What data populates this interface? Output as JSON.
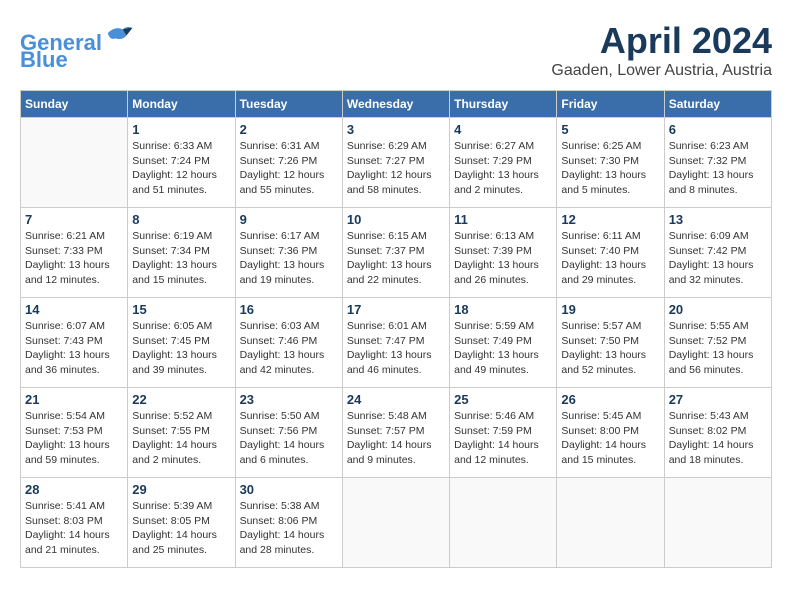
{
  "header": {
    "logo_line1": "General",
    "logo_line2": "Blue",
    "month": "April 2024",
    "location": "Gaaden, Lower Austria, Austria"
  },
  "weekdays": [
    "Sunday",
    "Monday",
    "Tuesday",
    "Wednesday",
    "Thursday",
    "Friday",
    "Saturday"
  ],
  "weeks": [
    [
      {
        "day": "",
        "info": ""
      },
      {
        "day": "1",
        "info": "Sunrise: 6:33 AM\nSunset: 7:24 PM\nDaylight: 12 hours\nand 51 minutes."
      },
      {
        "day": "2",
        "info": "Sunrise: 6:31 AM\nSunset: 7:26 PM\nDaylight: 12 hours\nand 55 minutes."
      },
      {
        "day": "3",
        "info": "Sunrise: 6:29 AM\nSunset: 7:27 PM\nDaylight: 12 hours\nand 58 minutes."
      },
      {
        "day": "4",
        "info": "Sunrise: 6:27 AM\nSunset: 7:29 PM\nDaylight: 13 hours\nand 2 minutes."
      },
      {
        "day": "5",
        "info": "Sunrise: 6:25 AM\nSunset: 7:30 PM\nDaylight: 13 hours\nand 5 minutes."
      },
      {
        "day": "6",
        "info": "Sunrise: 6:23 AM\nSunset: 7:32 PM\nDaylight: 13 hours\nand 8 minutes."
      }
    ],
    [
      {
        "day": "7",
        "info": "Sunrise: 6:21 AM\nSunset: 7:33 PM\nDaylight: 13 hours\nand 12 minutes."
      },
      {
        "day": "8",
        "info": "Sunrise: 6:19 AM\nSunset: 7:34 PM\nDaylight: 13 hours\nand 15 minutes."
      },
      {
        "day": "9",
        "info": "Sunrise: 6:17 AM\nSunset: 7:36 PM\nDaylight: 13 hours\nand 19 minutes."
      },
      {
        "day": "10",
        "info": "Sunrise: 6:15 AM\nSunset: 7:37 PM\nDaylight: 13 hours\nand 22 minutes."
      },
      {
        "day": "11",
        "info": "Sunrise: 6:13 AM\nSunset: 7:39 PM\nDaylight: 13 hours\nand 26 minutes."
      },
      {
        "day": "12",
        "info": "Sunrise: 6:11 AM\nSunset: 7:40 PM\nDaylight: 13 hours\nand 29 minutes."
      },
      {
        "day": "13",
        "info": "Sunrise: 6:09 AM\nSunset: 7:42 PM\nDaylight: 13 hours\nand 32 minutes."
      }
    ],
    [
      {
        "day": "14",
        "info": "Sunrise: 6:07 AM\nSunset: 7:43 PM\nDaylight: 13 hours\nand 36 minutes."
      },
      {
        "day": "15",
        "info": "Sunrise: 6:05 AM\nSunset: 7:45 PM\nDaylight: 13 hours\nand 39 minutes."
      },
      {
        "day": "16",
        "info": "Sunrise: 6:03 AM\nSunset: 7:46 PM\nDaylight: 13 hours\nand 42 minutes."
      },
      {
        "day": "17",
        "info": "Sunrise: 6:01 AM\nSunset: 7:47 PM\nDaylight: 13 hours\nand 46 minutes."
      },
      {
        "day": "18",
        "info": "Sunrise: 5:59 AM\nSunset: 7:49 PM\nDaylight: 13 hours\nand 49 minutes."
      },
      {
        "day": "19",
        "info": "Sunrise: 5:57 AM\nSunset: 7:50 PM\nDaylight: 13 hours\nand 52 minutes."
      },
      {
        "day": "20",
        "info": "Sunrise: 5:55 AM\nSunset: 7:52 PM\nDaylight: 13 hours\nand 56 minutes."
      }
    ],
    [
      {
        "day": "21",
        "info": "Sunrise: 5:54 AM\nSunset: 7:53 PM\nDaylight: 13 hours\nand 59 minutes."
      },
      {
        "day": "22",
        "info": "Sunrise: 5:52 AM\nSunset: 7:55 PM\nDaylight: 14 hours\nand 2 minutes."
      },
      {
        "day": "23",
        "info": "Sunrise: 5:50 AM\nSunset: 7:56 PM\nDaylight: 14 hours\nand 6 minutes."
      },
      {
        "day": "24",
        "info": "Sunrise: 5:48 AM\nSunset: 7:57 PM\nDaylight: 14 hours\nand 9 minutes."
      },
      {
        "day": "25",
        "info": "Sunrise: 5:46 AM\nSunset: 7:59 PM\nDaylight: 14 hours\nand 12 minutes."
      },
      {
        "day": "26",
        "info": "Sunrise: 5:45 AM\nSunset: 8:00 PM\nDaylight: 14 hours\nand 15 minutes."
      },
      {
        "day": "27",
        "info": "Sunrise: 5:43 AM\nSunset: 8:02 PM\nDaylight: 14 hours\nand 18 minutes."
      }
    ],
    [
      {
        "day": "28",
        "info": "Sunrise: 5:41 AM\nSunset: 8:03 PM\nDaylight: 14 hours\nand 21 minutes."
      },
      {
        "day": "29",
        "info": "Sunrise: 5:39 AM\nSunset: 8:05 PM\nDaylight: 14 hours\nand 25 minutes."
      },
      {
        "day": "30",
        "info": "Sunrise: 5:38 AM\nSunset: 8:06 PM\nDaylight: 14 hours\nand 28 minutes."
      },
      {
        "day": "",
        "info": ""
      },
      {
        "day": "",
        "info": ""
      },
      {
        "day": "",
        "info": ""
      },
      {
        "day": "",
        "info": ""
      }
    ]
  ]
}
